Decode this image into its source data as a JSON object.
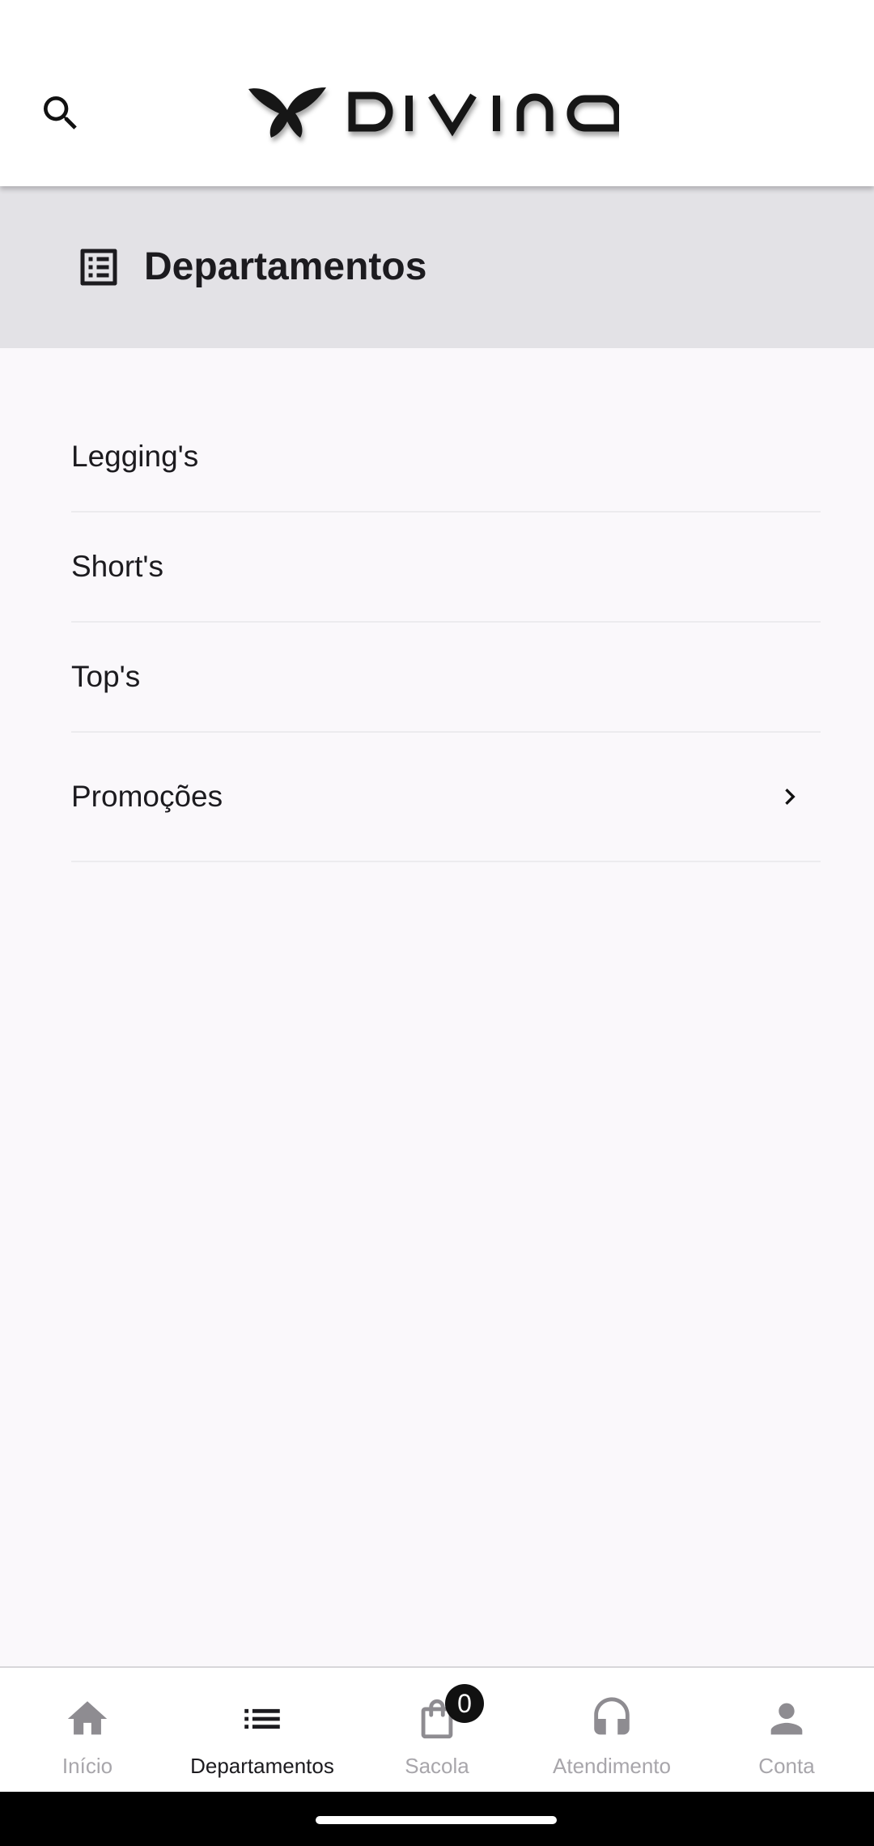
{
  "app": {
    "brand": "DIVINA",
    "colors": {
      "background": "#faf8fb",
      "header": "#ffffff",
      "section_bar": "#e3e2e6",
      "text_primary": "#1c1b1f",
      "nav_inactive": "#a8a6ab",
      "badge": "#111111"
    }
  },
  "header": {
    "search_icon": "search-icon",
    "logo_icon": "divina-logo"
  },
  "section": {
    "icon": "list-alt-icon",
    "title": "Departamentos"
  },
  "departments": {
    "items": [
      {
        "label": "Legging's",
        "has_chevron": false
      },
      {
        "label": "Short's",
        "has_chevron": false
      },
      {
        "label": "Top's",
        "has_chevron": false
      },
      {
        "label": "Promoções",
        "has_chevron": true,
        "chevron_icon": "chevron-right-icon"
      }
    ]
  },
  "bottom_nav": {
    "items": [
      {
        "label": "Início",
        "icon": "home-icon",
        "active": false
      },
      {
        "label": "Departamentos",
        "icon": "list-icon",
        "active": true
      },
      {
        "label": "Sacola",
        "icon": "shopping-bag-icon",
        "active": false,
        "badge": "0"
      },
      {
        "label": "Atendimento",
        "icon": "headset-icon",
        "active": false
      },
      {
        "label": "Conta",
        "icon": "person-icon",
        "active": false
      }
    ]
  }
}
